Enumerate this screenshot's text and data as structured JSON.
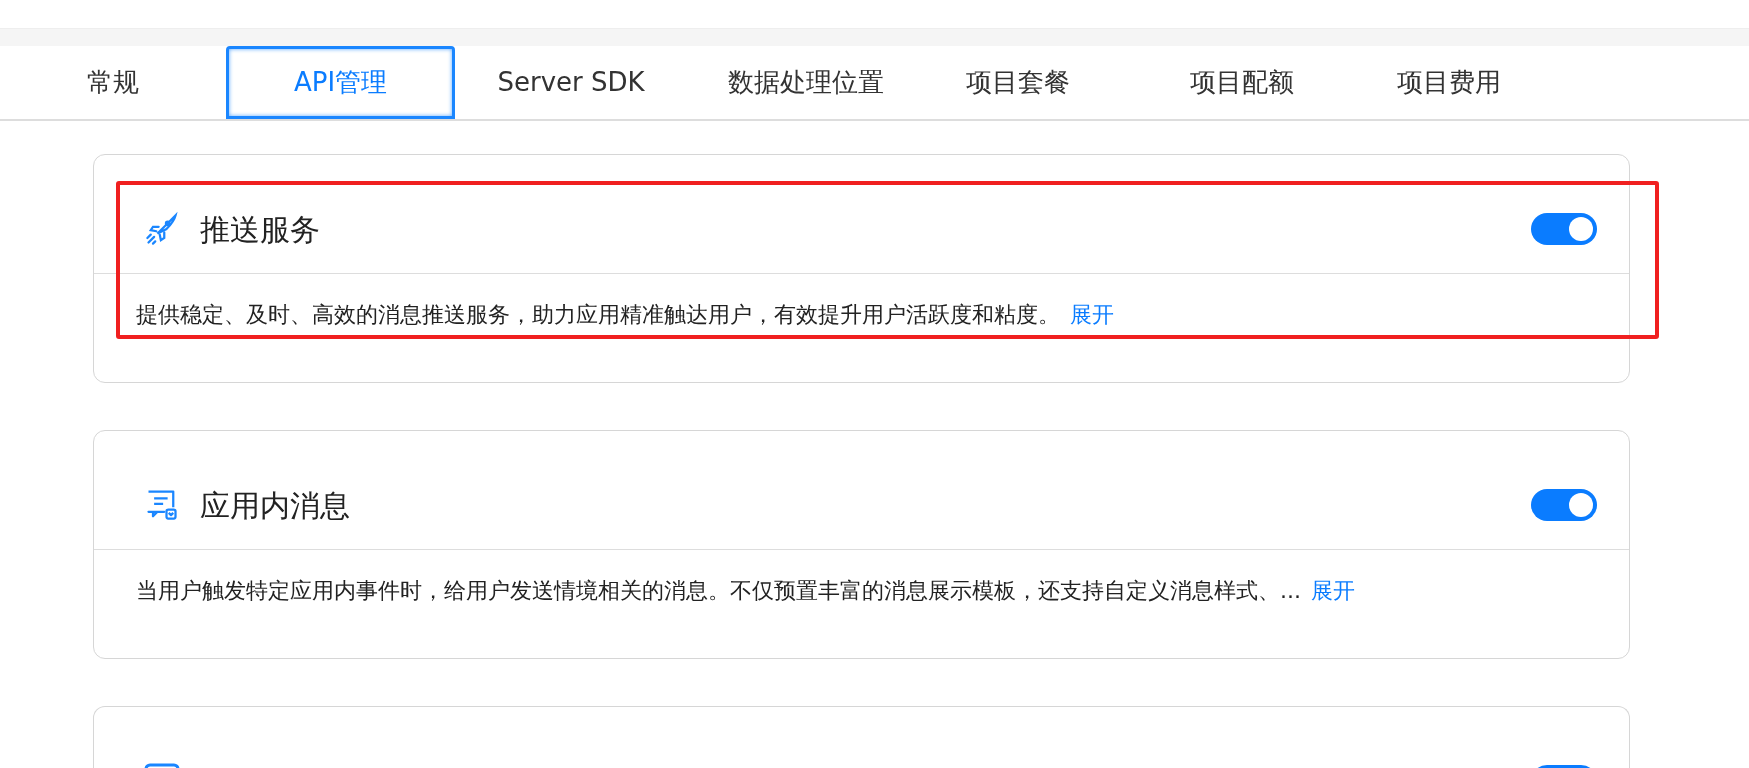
{
  "tabs": [
    {
      "label": "常规",
      "selected": false
    },
    {
      "label": "API管理",
      "selected": true
    },
    {
      "label": "Server SDK",
      "selected": false
    },
    {
      "label": "数据处理位置",
      "selected": false
    },
    {
      "label": "项目套餐",
      "selected": false
    },
    {
      "label": "项目配额",
      "selected": false
    },
    {
      "label": "项目费用",
      "selected": false
    }
  ],
  "cards": [
    {
      "title": "推送服务",
      "enabled": true,
      "highlighted": true,
      "description": "提供稳定、及时、高效的消息推送服务，助力应用精准触达用户，有效提升用户活跃度和粘度。",
      "link": "展开"
    },
    {
      "title": "应用内消息",
      "enabled": true,
      "highlighted": false,
      "description": "当用户触发特定应用内事件时，给用户发送情境相关的消息。不仅预置丰富的消息展示模板，还支持自定义消息样式、...",
      "link": "展开"
    },
    {
      "enabled": true,
      "highlighted": false
    }
  ]
}
